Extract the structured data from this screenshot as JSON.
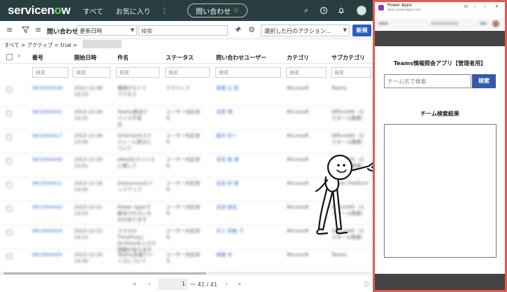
{
  "topbar": {
    "logo_text": "servicenow",
    "nav_all": "すべて",
    "nav_favorites": "お気に入り",
    "nav_more": "⋮",
    "context_pill": "問い合わせ",
    "context_star": "☆",
    "search_icon": "⌕",
    "history_icon": "◷",
    "bell_icon": "🔔",
    "avatar_icon": "user-avatar"
  },
  "listbar": {
    "menu_icon": "≡",
    "filter_icon": "⊽",
    "title": "問い合わせ",
    "field_select": "更新日時",
    "search_placeholder": "検索",
    "pin_icon": "➜",
    "settings_icon": "⚙",
    "action_select": "選択した行のアクション...",
    "new_button": "新規"
  },
  "breadcrumb": "すべて > アクティブ = true >",
  "columns": [
    "番号",
    "開始日時",
    "件名",
    "ステータス",
    "問い合わせユーザー",
    "カテゴリ",
    "サブカテゴリ"
  ],
  "filter_placeholder": "検索",
  "rows": [
    [
      "INC0004026",
      "2023-12-06\n10:23",
      "権限がなくて\nアクセス",
      "アクティブ",
      "栗栖 太 郎",
      "Microsoft",
      "Teams"
    ],
    [
      "INC0004901",
      "2023-12-26\n14:31",
      "Teams参加デ\nバイス不具\n合",
      "ユーザー対応待\nち",
      "吉野 理",
      "Microsoft",
      "Office365（ビ\nスタール関連）"
    ],
    [
      "INC0004417",
      "2023-12-26\n15:00",
      "OnDriveのスケ\nジュール表示に\nついて",
      "ユーザー対応待\nち",
      "藤井 利一",
      "Microsoft",
      "Office365（ビ\nスタール関連）"
    ],
    [
      "INC0004440",
      "2023-12-25\n10:01",
      "eMailのデバイス\nに関して",
      "ユーザー対応待\nち",
      "吉田 敦 理",
      "Microsoft",
      "Office365（ビ\nスタール関連）"
    ],
    [
      "INC0004411",
      "2023-12-18\n14:50",
      "Dataverseのバ\nックアップ",
      "ユーザー対応待\nち",
      "谷田 利 敦",
      "Microsoft",
      "Power Platform"
    ],
    [
      "INC0004402",
      "2023-12-21\n13:53",
      "Power Appsで\n解決されないも\nのがあります",
      "ユーザー対応待\nち",
      "吉田 健史",
      "Microsoft",
      "Office365（ビ\nスタール関連）"
    ],
    [
      "INC0004404",
      "2023-12-22\n14:12",
      "スマホの\nTimePlusに\nOnTimeを入力で\n問題があります",
      "ユーザー対応待\nち",
      "井上 和敏 子",
      "Microsoft",
      "Office365（ビ\nスタール関連）"
    ],
    [
      "INC0004400",
      "2023-12-20\n14:30",
      "Teams会議デバ\nイスについて",
      "ユーザー対応待\nち",
      "真鍋 冬",
      "Microsoft",
      "Teams"
    ]
  ],
  "pager": {
    "first": "«",
    "prev": "‹",
    "page": "1",
    "range": "～ 41 / 41",
    "next": "›",
    "last": "»",
    "help_icon": "ⓘ"
  },
  "powerapps": {
    "window_title": "Power Apps",
    "window_url": "apps.powerapps.com",
    "app_title": "Teams情報照会アプリ【管理者用】",
    "search_placeholder": "チーム名で検索",
    "search_button": "検索",
    "results_title": "チーム検索結果",
    "win_buttons": [
      "⊡",
      "‹",
      "›",
      "✕"
    ]
  },
  "colors": {
    "topbar": "#293e40",
    "logo_accent": "#62d84e",
    "new_button": "#2a5fc1",
    "powerapps_frame": "#e2584f",
    "powerapps_button": "#3658a8",
    "powerapps_bar": "#444444"
  }
}
